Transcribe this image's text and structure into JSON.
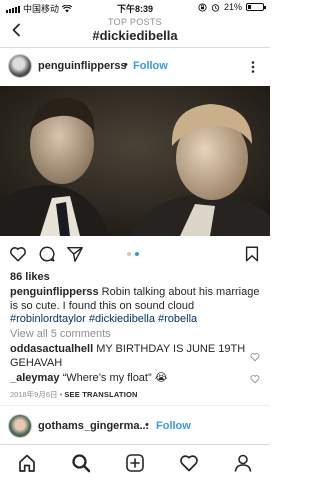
{
  "status_bar": {
    "carrier": "中国移动",
    "time": "下午8:39",
    "battery": "21%",
    "battery_level": 0.21
  },
  "header": {
    "subtitle": "TOP POSTS",
    "title": "#dickiedibella"
  },
  "post": {
    "username": "penguinflipperss",
    "follow_label": "Follow",
    "likes": "86 likes",
    "caption": {
      "username": "penguinflipperss",
      "text": " Robin talking about his marriage is so cute. I found this on sound cloud ",
      "hashtags": [
        "#robinlordtaylor",
        "#dickiedibella",
        "#robella"
      ]
    },
    "view_all_comments": "View all 5 comments",
    "comments": [
      {
        "username": "oddasactualhell",
        "text": "MY BIRTHDAY IS JUNE 19TH GEHAVAH"
      },
      {
        "username": "_aleymay",
        "text": "“Where’s my float” 😭"
      }
    ],
    "date": "2018年9月6日",
    "separator": "•",
    "see_translation": "SEE TRANSLATION",
    "carousel": {
      "count": 2,
      "active": 1
    }
  },
  "next_post": {
    "username": "gothams_gingerma...",
    "follow_label": "Follow"
  },
  "colors": {
    "accent": "#3897f0",
    "hashtag": "#003569",
    "text": "#262626",
    "muted": "#8e8e8e"
  },
  "icons": {
    "header": [
      "back-icon"
    ],
    "post": [
      "more-icon",
      "heart-icon",
      "comment-icon",
      "share-icon",
      "bookmark-icon"
    ],
    "tabbar": [
      "home-icon",
      "search-icon",
      "add-icon",
      "activity-icon",
      "profile-icon"
    ]
  }
}
